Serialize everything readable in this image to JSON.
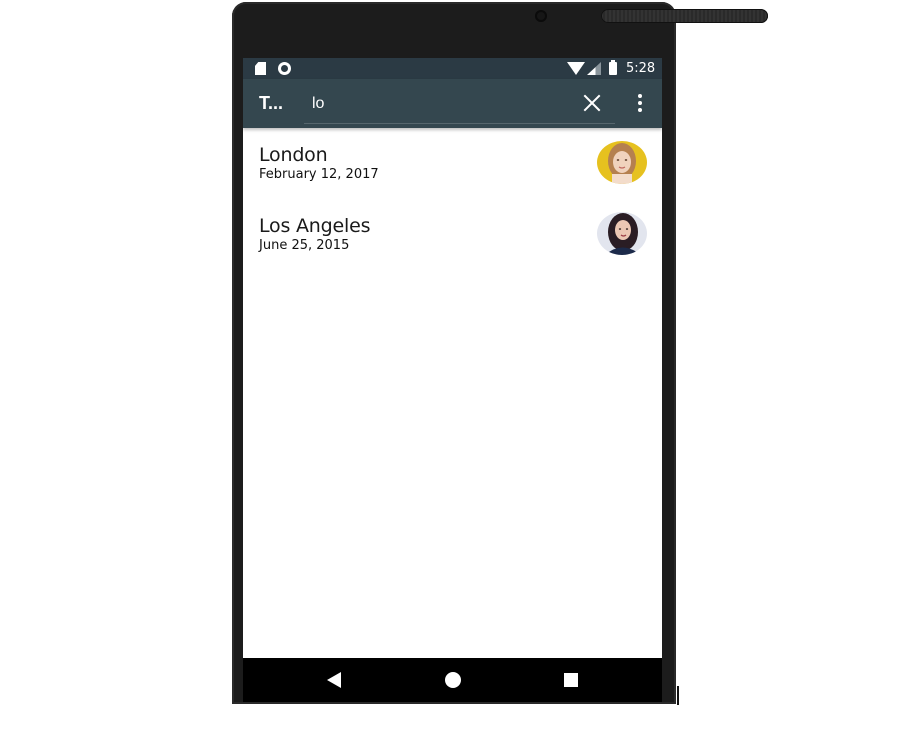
{
  "status_bar": {
    "time": "5:28",
    "icons": [
      "sd-card-icon",
      "sync-circle-icon",
      "wifi-icon",
      "cell-signal-icon",
      "battery-icon"
    ]
  },
  "toolbar": {
    "title": "T...",
    "search": {
      "value": "lo",
      "placeholder": ""
    },
    "clear_icon": "close-icon",
    "overflow_icon": "more-vert-icon",
    "background": "#34474f"
  },
  "results": [
    {
      "title": "London",
      "date": "February 12, 2017",
      "avatar": "woman-portrait-avatar",
      "avatar_bg": "#e8c21a"
    },
    {
      "title": "Los Angeles",
      "date": "June 25, 2015",
      "avatar": "woman-portrait-avatar",
      "avatar_bg": "#dfe3ee"
    }
  ],
  "nav_bar": {
    "buttons": [
      "back-icon",
      "home-icon",
      "recents-icon"
    ]
  },
  "colors": {
    "status_bar": "#2b3a44",
    "app_bar": "#34474f",
    "nav_bar": "#000000",
    "bezel": "#1c1c1c"
  }
}
